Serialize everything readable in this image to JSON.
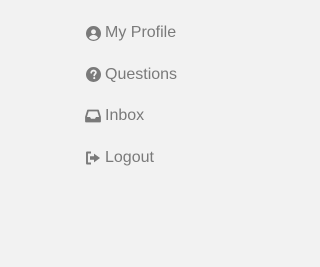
{
  "menu": {
    "items": [
      {
        "label": "My Profile",
        "icon": "user-circle-icon"
      },
      {
        "label": "Questions",
        "icon": "question-circle-icon"
      },
      {
        "label": "Inbox",
        "icon": "inbox-icon"
      },
      {
        "label": "Logout",
        "icon": "sign-out-icon"
      }
    ]
  },
  "colors": {
    "background": "#f2f2f2",
    "text": "#7a7a7a",
    "icon": "#7a7a7a"
  }
}
